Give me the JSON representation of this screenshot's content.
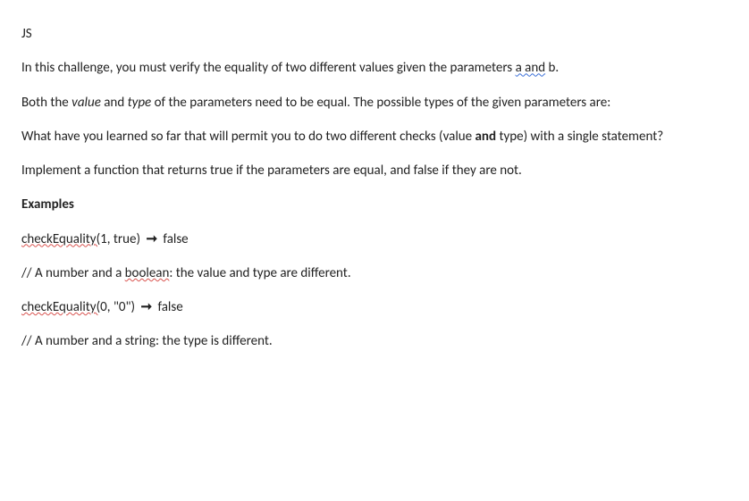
{
  "title": "JS",
  "p1": {
    "t1": "In this challenge, you must verify the equality of two different values given the parameters ",
    "a_and": "a and",
    "t2": " b."
  },
  "p2": {
    "t1": "Both the ",
    "value": "value",
    "t2": " and ",
    "type": "type",
    "t3": " of the parameters need to be equal. The possible types of the given parameters are:"
  },
  "p3": {
    "t1": "What have you learned so far that will permit you to do two different checks (value ",
    "and": "and",
    "t2": " type) with a single statement?"
  },
  "p4": "Implement a function that returns true if the parameters are equal, and false if they are not.",
  "examples_label": "Examples",
  "ex1": {
    "fn": "checkEquality(",
    "args": "1,  true) ",
    "arrow": "➞",
    "result": " false"
  },
  "c1": {
    "pre": "// A number and a ",
    "err": "boolean",
    "post": ": the value and type are different."
  },
  "ex2": {
    "fn": "checkEquality(",
    "args": "0,  \"0\") ",
    "arrow": "➞",
    "result": " false"
  },
  "c2": "// A number and a string: the type is different."
}
